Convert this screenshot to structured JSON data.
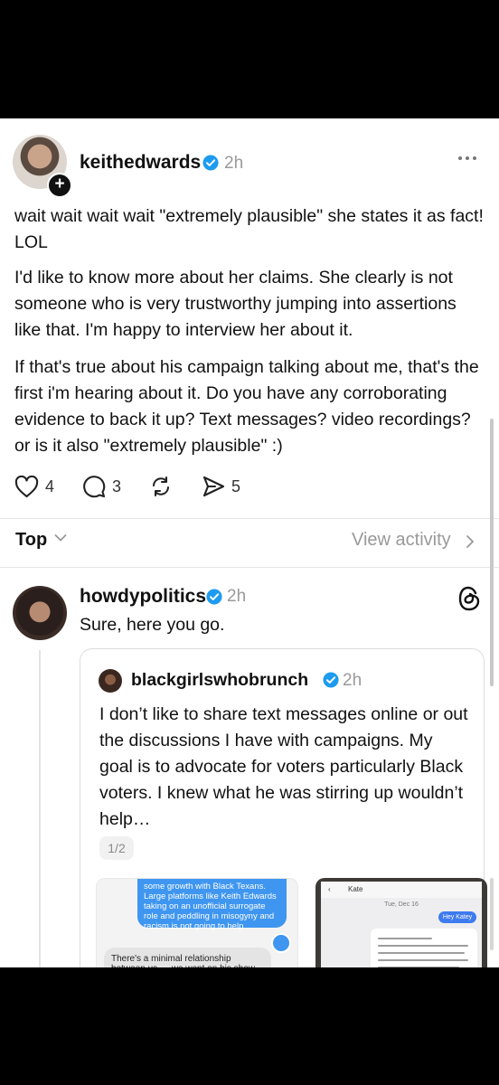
{
  "post": {
    "username": "keithedwards",
    "time": "2h",
    "paragraphs": [
      "wait wait wait wait \"extremely plausible\" she states it as fact! LOL",
      "I'd like to know more about her claims. She clearly is not someone who is very trustworthy jumping into assertions like that. I'm happy to interview her about it.",
      "If that's true about his campaign talking about me, that's the first i'm hearing about it. Do you have any corroborating evidence to back it up? Text messages? video recordings?  or is it also \"extremely plausible\" :)"
    ],
    "actions": {
      "likes": "4",
      "comments": "3",
      "reposts": "",
      "shares": "5"
    }
  },
  "sort": {
    "label": "Top",
    "view_activity": "View activity"
  },
  "reply": {
    "username": "howdypolitics",
    "time": "2h",
    "text": "Sure, here you go.",
    "quote": {
      "username": "blackgirlswhobrunch",
      "time": "2h",
      "text": "I don’t like to share text messages online or out the discussions I have with campaigns. My goal is to advocate for voters particularly Black voters.  I knew what he was stirring up wouldn’t help…",
      "page_indicator": "1/2",
      "screenshot1": {
        "blue_message": "some growth with Black Texans. Large platforms like Keith Edwards taking on an unofficial surrogate role and peddling in misogyny and racism is not going to help",
        "gray_message": "There's a minimal relationship between us — we went on his show early on in"
      },
      "screenshot2": {
        "contact": "Kate",
        "date": "Tue, Dec 16",
        "sent_message": "Hey Katey"
      }
    }
  },
  "icons": {
    "verified": "verified-badge-icon",
    "more": "more-dots-icon",
    "heart": "heart-icon",
    "comment": "comment-bubble-icon",
    "repost": "repost-icon",
    "share": "share-send-icon",
    "threads": "threads-logo-icon",
    "plus": "follow-plus-icon"
  },
  "colors": {
    "verified_blue": "#1d9bf0",
    "text": "#111111",
    "muted": "#9a9a9a"
  }
}
